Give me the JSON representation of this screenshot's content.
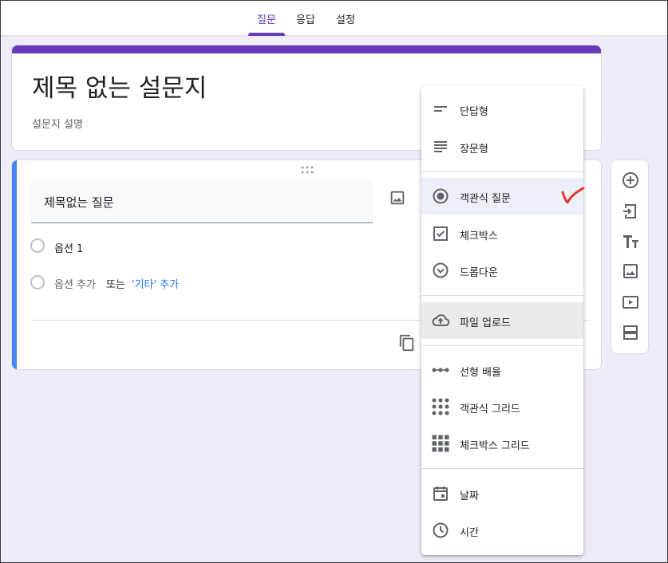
{
  "tabs": [
    {
      "label": "질문",
      "active": true
    },
    {
      "label": "응답",
      "active": false
    },
    {
      "label": "설정",
      "active": false
    }
  ],
  "form": {
    "title": "제목 없는 설문지",
    "description": "설문지 설명"
  },
  "question": {
    "title": "제목없는 질문",
    "option1": "옵션 1",
    "add_option": "옵션 추가",
    "or": "또는",
    "add_other": "'기타' 추가"
  },
  "menu": {
    "items": [
      {
        "label": "단답형",
        "icon": "short-answer-icon"
      },
      {
        "label": "장문형",
        "icon": "paragraph-icon"
      },
      {
        "label": "객관식 질문",
        "icon": "radio-icon",
        "selected": true
      },
      {
        "label": "체크박스",
        "icon": "checkbox-icon"
      },
      {
        "label": "드롭다운",
        "icon": "dropdown-icon"
      },
      {
        "label": "파일 업로드",
        "icon": "cloud-upload-icon",
        "hovered": true
      },
      {
        "label": "선형 배율",
        "icon": "linear-scale-icon"
      },
      {
        "label": "객관식 그리드",
        "icon": "grid-dots-icon"
      },
      {
        "label": "체크박스 그리드",
        "icon": "grid-squares-icon"
      },
      {
        "label": "날짜",
        "icon": "calendar-icon"
      },
      {
        "label": "시간",
        "icon": "clock-icon"
      }
    ]
  },
  "colors": {
    "accent": "#673ab7",
    "question_bar": "#4285f4",
    "background": "#f0ebf8",
    "link": "#1a73e8",
    "annotation": "#e53935"
  }
}
